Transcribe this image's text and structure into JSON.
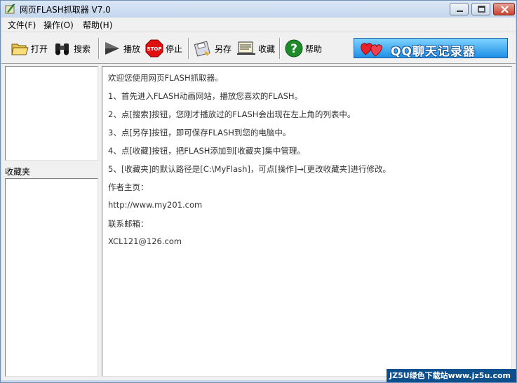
{
  "window": {
    "title": "网页FLASH抓取器 V7.0"
  },
  "menu": [
    {
      "label": "文件(F)"
    },
    {
      "label": "操作(O)"
    },
    {
      "label": "帮助(H)"
    }
  ],
  "toolbar": {
    "open_label": "打开",
    "search_label": "搜索",
    "play_label": "播放",
    "stop_label": "停止",
    "saveas_label": "另存",
    "favorite_label": "收藏",
    "help_label": "帮助",
    "banner_text": "QQ聊天记录器",
    "stop_icon_text": "STOP"
  },
  "left": {
    "favorites_label": "收藏夹"
  },
  "main": {
    "lines": [
      "欢迎您使用网页FLASH抓取器。",
      "1、首先进入FLASH动画网站，播放您喜欢的FLASH。",
      "2、点[搜索]按钮，您刚才播放过的FLASH会出现在左上角的列表中。",
      "3、点[另存]按钮，即可保存FLASH到您的电脑中。",
      "4、点[收藏]按钮，把FLASH添加到[收藏夹]集中管理。",
      "5、[收藏夹]的默认路径是[C:\\MyFlash]，可点[操作]→[更改收藏夹]进行修改。",
      "作者主页：",
      "http://www.my201.com",
      "联系邮箱：",
      "XCL121@126.com"
    ]
  },
  "watermark": {
    "text": "JZ5U绿色下载站www.jz5u.com"
  },
  "colors": {
    "title_bar": "#c4d6ed",
    "close_button": "#c8402e",
    "banner": "#1f8fe6",
    "watermark_bg": "#0b4f8c"
  }
}
